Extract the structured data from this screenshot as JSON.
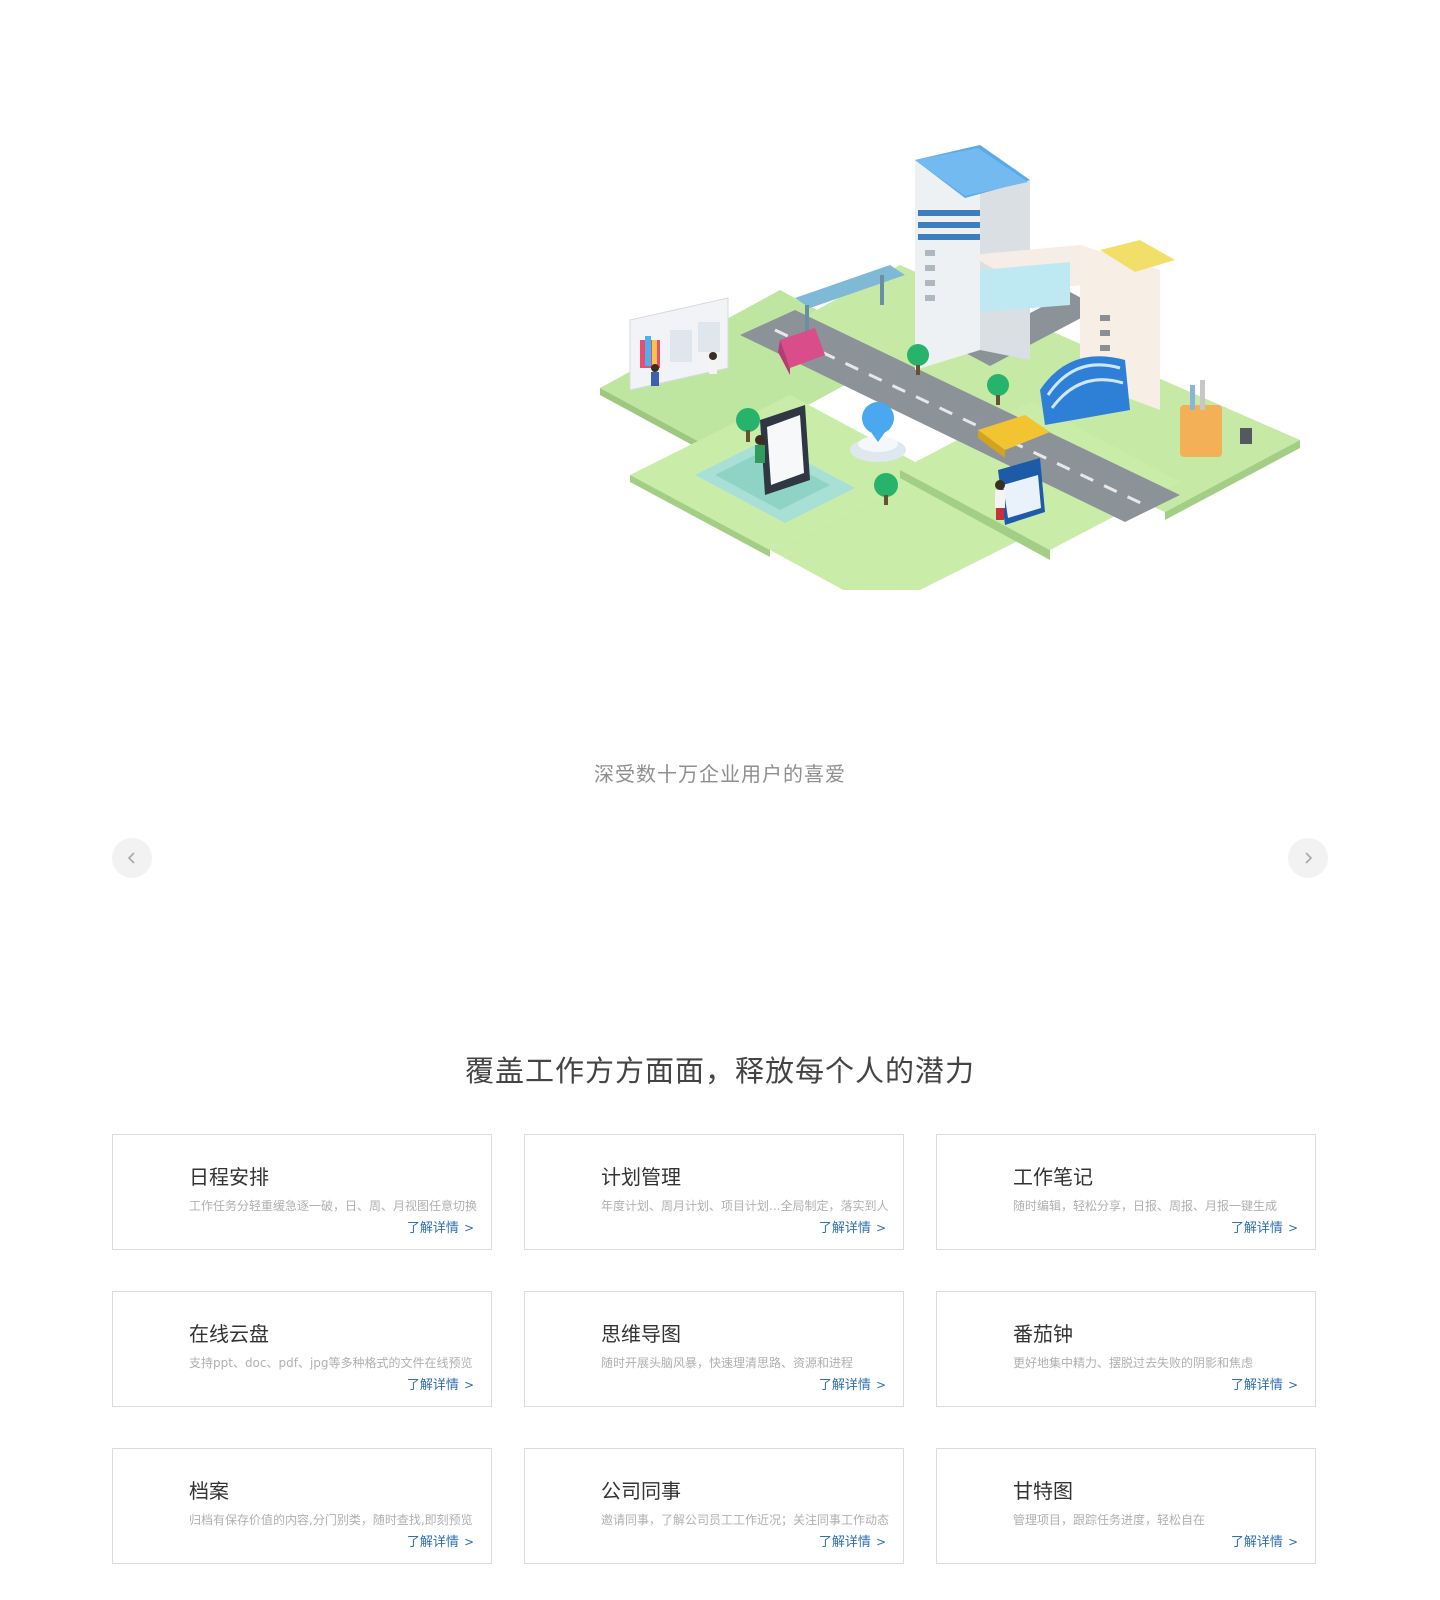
{
  "hero": {
    "illustration_icon": "isometric-office-city-illustration"
  },
  "tagline": "深受数十万企业用户的喜爱",
  "carousel": {
    "prev_icon": "chevron-left-icon",
    "next_icon": "chevron-right-icon"
  },
  "features": {
    "title": "覆盖工作方方面面，释放每个人的潜力",
    "link_label": "了解详情",
    "link_icon": "chevron-right-icon",
    "items": [
      {
        "title": "日程安排",
        "desc": "工作任务分轻重缓急逐一破，日、周、月视图任意切换"
      },
      {
        "title": "计划管理",
        "desc": "年度计划、周月计划、项目计划...全局制定，落实到人"
      },
      {
        "title": "工作笔记",
        "desc": "随时编辑，轻松分享，日报、周报、月报一键生成"
      },
      {
        "title": "在线云盘",
        "desc": "支持ppt、doc、pdf、jpg等多种格式的文件在线预览"
      },
      {
        "title": "思维导图",
        "desc": "随时开展头脑风暴，快速理清思路、资源和进程"
      },
      {
        "title": "番茄钟",
        "desc": "更好地集中精力、摆脱过去失败的阴影和焦虑"
      },
      {
        "title": "档案",
        "desc": "归档有保存价值的内容,分门别类，随时查找,即刻预览"
      },
      {
        "title": "公司同事",
        "desc": "邀请同事，了解公司员工工作近况；关注同事工作动态"
      },
      {
        "title": "甘特图",
        "desc": "管理项目，跟踪任务进度，轻松自在"
      }
    ]
  }
}
